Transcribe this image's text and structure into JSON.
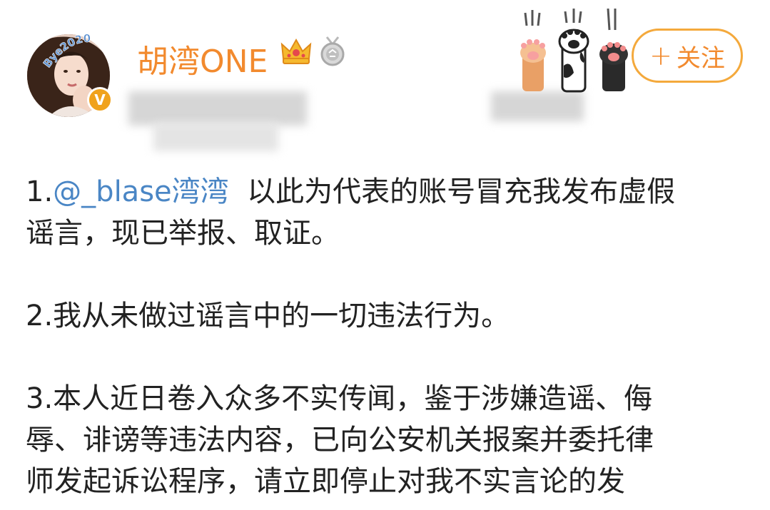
{
  "header": {
    "username": "胡湾ONE",
    "avatar_ring_text": "Bye2020",
    "verified_mark": "V",
    "follow_button": {
      "plus": "+",
      "label": "关注"
    },
    "icons": {
      "crown": "crown-icon",
      "medal": "medal-icon",
      "paws": [
        "orange-paw-icon",
        "cow-paw-icon",
        "black-paw-icon"
      ]
    }
  },
  "post": {
    "p1_index": "1.",
    "p1_mention": "@_blase湾湾",
    "p1_line1_rest": "  以此为代表的账号冒充我发布虚假",
    "p1_line2": "谣言，现已举报、取证。",
    "p2": "2.我从未做过谣言中的一切违法行为。",
    "p3_line1": "3.本人近日卷入众多不实传闻，鉴于涉嫌造谣、侮",
    "p3_line2": "辱、诽谤等违法内容，已向公安机关报案并委托律",
    "p3_line3": "师发起诉讼程序，请立即停止对我不实言论的发"
  },
  "colors": {
    "username": "#f28a2e",
    "mention": "#4a86c5",
    "follow_border": "#f4a93c",
    "badge": "#f0a21c",
    "text": "#222222"
  }
}
